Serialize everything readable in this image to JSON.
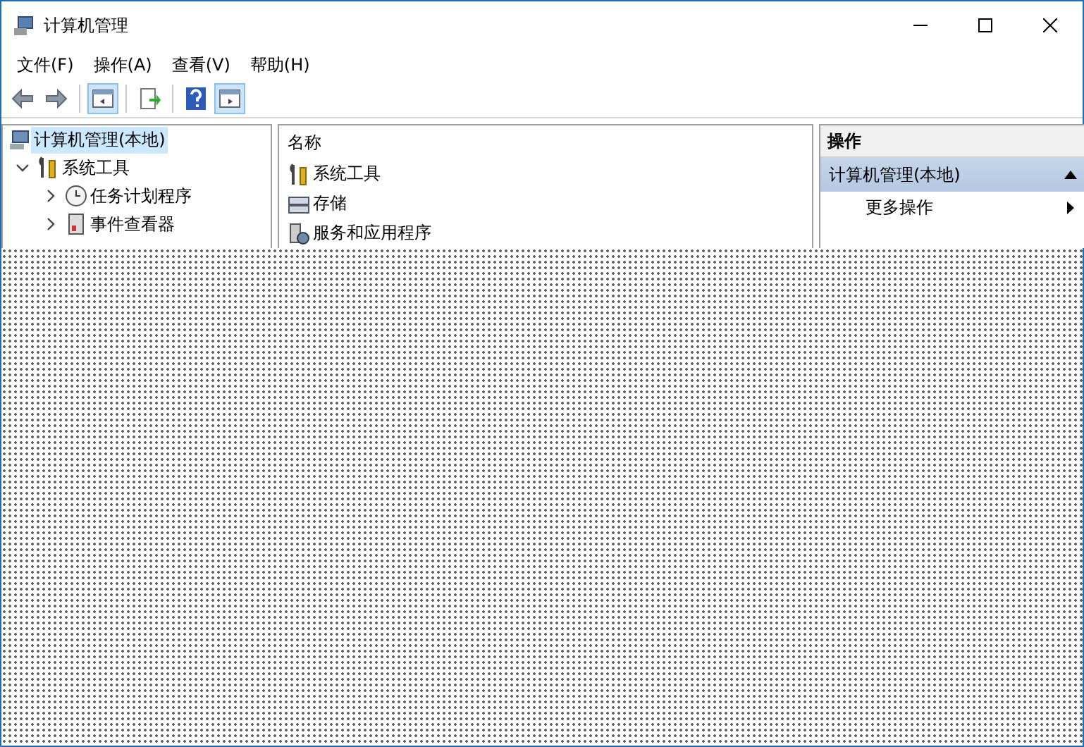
{
  "window": {
    "title": "计算机管理"
  },
  "menu": [
    "文件(F)",
    "操作(A)",
    "查看(V)",
    "帮助(H)"
  ],
  "toolbar": [
    {
      "kind": "back",
      "on": false
    },
    {
      "kind": "forward",
      "on": false
    },
    {
      "kind": "separator"
    },
    {
      "kind": "console-tree",
      "on": true
    },
    {
      "kind": "separator"
    },
    {
      "kind": "export",
      "on": false
    },
    {
      "kind": "separator"
    },
    {
      "kind": "help",
      "on": false
    },
    {
      "kind": "action-pane",
      "on": true
    }
  ],
  "tree": [
    {
      "label": "计算机管理(本地)",
      "kind": "computer",
      "selected": true,
      "children": [
        {
          "label": "系统工具",
          "kind": "tools",
          "selected": false,
          "expanded": true,
          "children": [
            {
              "label": "任务计划程序",
              "kind": "clock",
              "selected": false,
              "expanded": false
            },
            {
              "label": "事件查看器",
              "kind": "log",
              "selected": false,
              "expanded": false
            }
          ]
        }
      ]
    }
  ],
  "list": {
    "column": "名称",
    "items": [
      {
        "label": "系统工具",
        "kind": "tools"
      },
      {
        "label": "存储",
        "kind": "storage"
      },
      {
        "label": "服务和应用程序",
        "kind": "services"
      }
    ]
  },
  "actions": {
    "title": "操作",
    "group": "计算机管理(本地)",
    "expanded": true,
    "items": [
      "更多操作"
    ]
  }
}
